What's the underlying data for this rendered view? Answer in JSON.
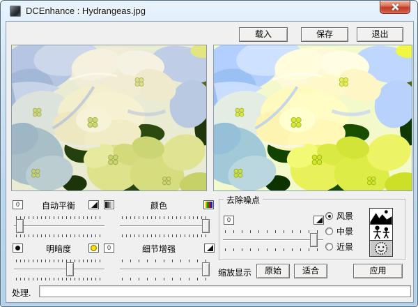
{
  "window": {
    "title": "DCEnhance : Hydrangeas.jpg"
  },
  "toolbar": {
    "load": "载入",
    "save": "保存",
    "exit": "退出"
  },
  "controls": {
    "auto_balance": {
      "label": "自动平衡",
      "reset": "0",
      "value_percent": 3
    },
    "color": {
      "label": "颜色",
      "value_percent": 100
    },
    "brightness": {
      "label": "明暗度",
      "value_percent": 63
    },
    "detail": {
      "label": "细节增强",
      "reset": "0",
      "value_percent": 100
    },
    "noise": {
      "label": "去除噪点",
      "reset": "0",
      "value_percent": 93,
      "modes": [
        {
          "label": "风景",
          "selected": true
        },
        {
          "label": "中景",
          "selected": false
        },
        {
          "label": "近景",
          "selected": false
        }
      ]
    },
    "zoom_display": {
      "label": "缩放显示",
      "original": "原始",
      "fit": "适合"
    },
    "apply": "应用",
    "process": {
      "label": "处理."
    }
  },
  "icons": {
    "close": "close-x-shape",
    "app": "photo-thumbnail",
    "auto_balance_right": "black-triangle-gradient",
    "color_left": "gray-steps-contrast",
    "color_right": "rgb-stripes",
    "brightness_left": "black-circle",
    "brightness_right": "yellow-sun",
    "detail_right": "black-triangle-gradient",
    "noise_right": "black-triangle-gradient",
    "mode_landscape": "mountains-with-sun",
    "mode_medium": "two-stick-figures",
    "mode_closeup": "smiley-face"
  },
  "colors": {
    "close_red": "#bd3a22",
    "frame_blue": "#bcd7ee",
    "client_gray": "#f0f0f0",
    "status_field": "#ffffff"
  }
}
